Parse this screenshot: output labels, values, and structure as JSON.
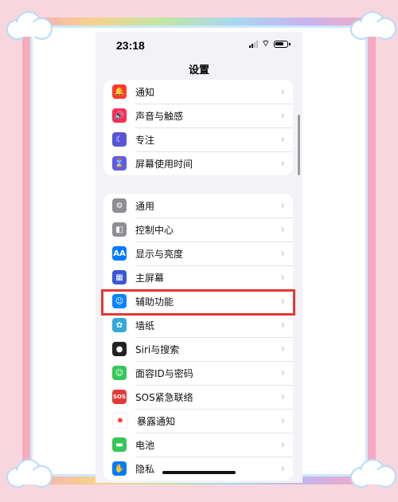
{
  "status_bar": {
    "time": "23:18"
  },
  "nav": {
    "title": "设置"
  },
  "groups": [
    {
      "items": [
        {
          "label": "通知",
          "icon": "bell-icon",
          "color": "#ff3b30",
          "glyph": "🔔"
        },
        {
          "label": "声音与触感",
          "icon": "speaker-icon",
          "color": "#ff2d55",
          "glyph": "🔊"
        },
        {
          "label": "专注",
          "icon": "moon-icon",
          "color": "#5856d6",
          "glyph": "☾"
        },
        {
          "label": "屏幕使用时间",
          "icon": "hourglass-icon",
          "color": "#5e5ce6",
          "glyph": "⌛"
        }
      ]
    },
    {
      "items": [
        {
          "label": "通用",
          "icon": "gear-icon",
          "color": "#8e8e93",
          "glyph": "⚙"
        },
        {
          "label": "控制中心",
          "icon": "toggles-icon",
          "color": "#8e8e93",
          "glyph": "◧"
        },
        {
          "label": "显示与亮度",
          "icon": "text-size-icon",
          "color": "#007aff",
          "glyph": "AA"
        },
        {
          "label": "主屏幕",
          "icon": "home-grid-icon",
          "color": "#3a57d8",
          "glyph": "▦"
        },
        {
          "label": "辅助功能",
          "icon": "accessibility-icon",
          "color": "#0a84ff",
          "glyph": "☺"
        },
        {
          "label": "墙纸",
          "icon": "wallpaper-flower-icon",
          "color": "#34aadc",
          "glyph": "✿"
        },
        {
          "label": "Siri与搜索",
          "icon": "siri-icon",
          "color": "#222222",
          "glyph": "●"
        },
        {
          "label": "面容ID与密码",
          "icon": "face-id-icon",
          "color": "#34c759",
          "glyph": "☺"
        },
        {
          "label": "SOS紧急联络",
          "icon": "sos-icon",
          "color": "#e53935",
          "glyph": "SOS"
        },
        {
          "label": "暴露通知",
          "icon": "exposure-icon",
          "color": "#ffffff",
          "glyph": "✹"
        },
        {
          "label": "电池",
          "icon": "battery-icon",
          "color": "#34c759",
          "glyph": "▬"
        },
        {
          "label": "隐私",
          "icon": "hand-icon",
          "color": "#007aff",
          "glyph": "✋"
        }
      ]
    }
  ],
  "highlight_item": "辅助功能"
}
